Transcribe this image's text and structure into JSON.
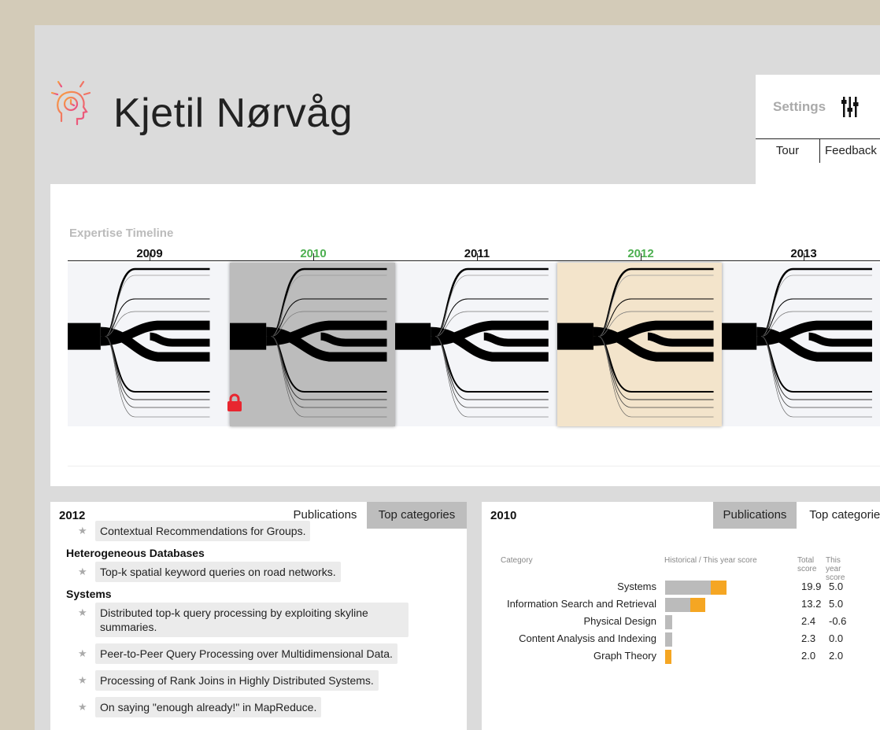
{
  "header": {
    "name": "Kjetil Nørvåg",
    "settings_label": "Settings",
    "tour_label": "Tour",
    "feedback_label": "Feedback"
  },
  "timeline": {
    "title": "Expertise Timeline",
    "years": [
      {
        "label": "2009",
        "highlight": false
      },
      {
        "label": "2010",
        "highlight": true
      },
      {
        "label": "2011",
        "highlight": false
      },
      {
        "label": "2012",
        "highlight": true
      },
      {
        "label": "2013",
        "highlight": false
      }
    ],
    "colors": {
      "highlight": "#4caf50",
      "locked": "#bcbcbc",
      "selected": "#f3e4cb",
      "lock": "#e8262f"
    }
  },
  "left_panel": {
    "year": "2012",
    "tab_publications": "Publications",
    "tab_top_categories": "Top categories",
    "truncated_item": "Contextual Recommendations for Groups.",
    "groups": [
      {
        "category": "Heterogeneous Databases",
        "items": [
          "Top-k spatial keyword queries on road networks."
        ]
      },
      {
        "category": "Systems",
        "items": [
          "Distributed top-k query processing by exploiting skyline summaries.",
          "Peer-to-Peer Query Processing over Multidimensional Data.",
          "Processing of Rank Joins in Highly Distributed Systems.",
          "On saying \"enough already!\" in MapReduce."
        ]
      }
    ]
  },
  "right_panel": {
    "year": "2010",
    "tab_publications": "Publications",
    "tab_top_categories": "Top categories",
    "col_category": "Category",
    "col_hist": "Historical / This year score",
    "col_total": "Total score",
    "col_thisyear": "This year score",
    "colors": {
      "historical": "#bbbbbb",
      "this_year": "#f5a623"
    },
    "rows": [
      {
        "category": "Systems",
        "total": "19.9",
        "this_year": "5.0",
        "total_value": 19.9,
        "this_year_value": 5.0
      },
      {
        "category": "Information Search and Retrieval",
        "total": "13.2",
        "this_year": "5.0",
        "total_value": 13.2,
        "this_year_value": 5.0
      },
      {
        "category": "Physical Design",
        "total": "2.4",
        "this_year": "-0.6",
        "total_value": 2.4,
        "this_year_value": -0.6
      },
      {
        "category": "Content Analysis and Indexing",
        "total": "2.3",
        "this_year": "0.0",
        "total_value": 2.3,
        "this_year_value": 0.0
      },
      {
        "category": "Graph Theory",
        "total": "2.0",
        "this_year": "2.0",
        "total_value": 2.0,
        "this_year_value": 2.0
      }
    ]
  }
}
